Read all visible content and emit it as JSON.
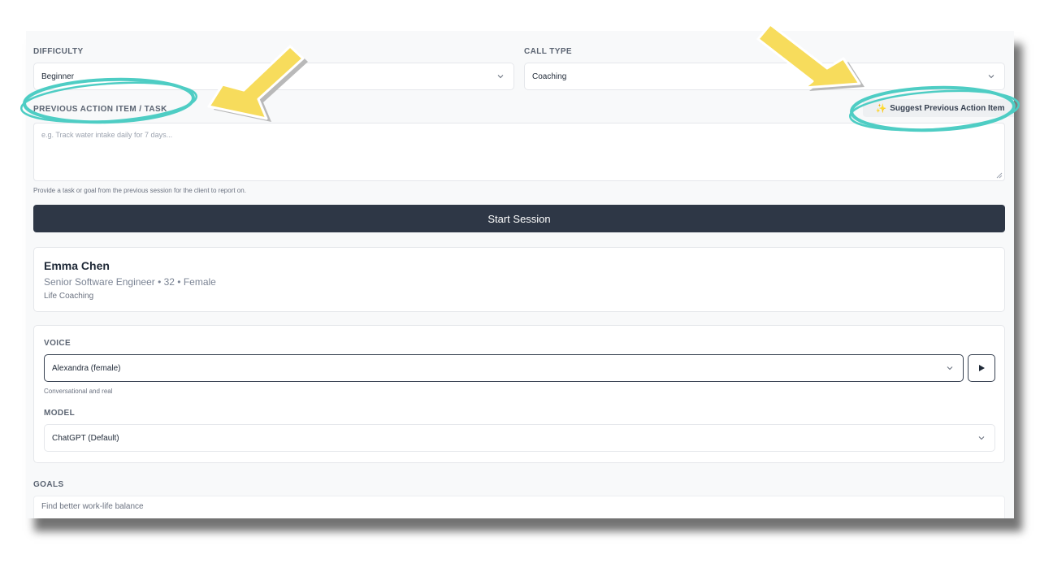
{
  "difficulty": {
    "label": "DIFFICULTY",
    "value": "Beginner"
  },
  "call_type": {
    "label": "CALL TYPE",
    "value": "Coaching"
  },
  "previous_action": {
    "label": "PREVIOUS ACTION ITEM / TASK",
    "suggest_label": "Suggest Previous Action Item",
    "placeholder": "e.g. Track water intake daily for 7 days...",
    "hint": "Provide a task or goal from the previous session for the client to report on."
  },
  "start_button": {
    "label": "Start Session"
  },
  "client": {
    "name": "Emma Chen",
    "details": "Senior Software Engineer • 32 • Female",
    "category": "Life Coaching"
  },
  "voice": {
    "label": "VOICE",
    "value": "Alexandra (female)",
    "description": "Conversational and real"
  },
  "model": {
    "label": "MODEL",
    "value": "ChatGPT (Default)"
  },
  "goals": {
    "label": "GOALS",
    "first_goal": "Find better work-life balance"
  },
  "colors": {
    "primary_button": "#2e3746",
    "highlight_circle": "#4ecdc4",
    "arrow": "#f7dc5c"
  }
}
